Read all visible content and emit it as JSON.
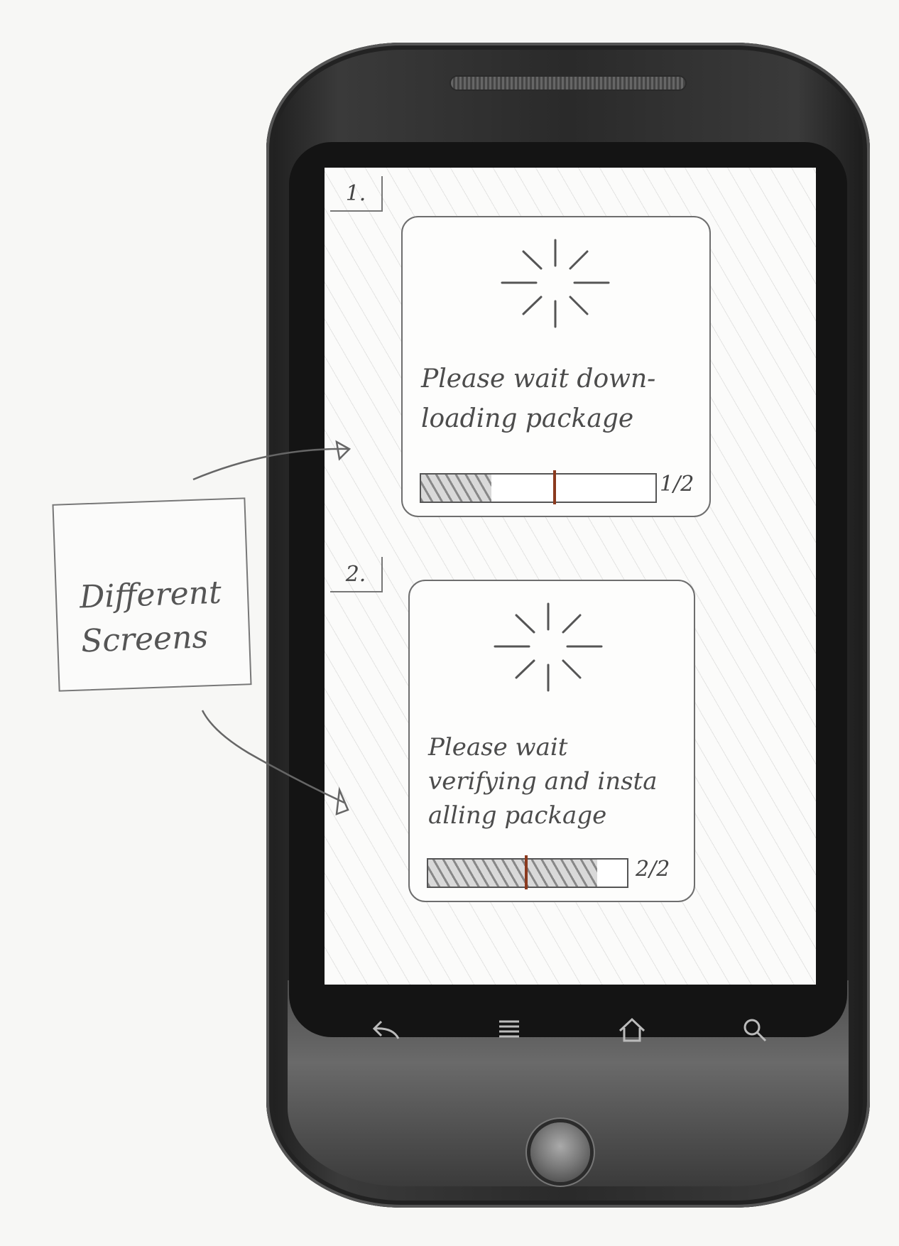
{
  "annotation": {
    "note_text": "Different\nScreens"
  },
  "screens": [
    {
      "step_label": "1.",
      "message": "Please wait down-\nloading package",
      "progress_fraction": 0.3,
      "progress_count": "1/2"
    },
    {
      "step_label": "2.",
      "message": "Please wait\nverifying and insta\nalling package",
      "progress_fraction": 0.85,
      "progress_count": "2/2"
    }
  ],
  "nav_bar": {
    "icons": [
      "back-icon",
      "menu-icon",
      "home-icon",
      "search-icon"
    ]
  },
  "colors": {
    "phone_body": "#2a2a2a",
    "screen_bg": "#fbfbfa",
    "sketch_ink": "#555555",
    "progress_marker": "#8b3a1e"
  }
}
